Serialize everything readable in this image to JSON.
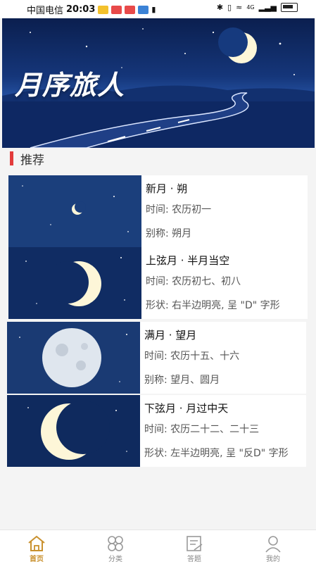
{
  "status_bar": {
    "carrier": "中国电信",
    "time": "20:03",
    "right_text": "4G"
  },
  "banner": {
    "title": "月序旅人"
  },
  "section": {
    "title": "推荐"
  },
  "cards": [
    {
      "title": "新月 · 朔",
      "line1": "时间:  农历初一",
      "line2": "别称:  朔月"
    },
    {
      "title": "上弦月 · 半月当空",
      "line1": "时间:  农历初七、初八",
      "line2": "形状:  右半边明亮, 呈 \"D\" 字形"
    },
    {
      "title": "满月 · 望月",
      "line1": "时间:  农历十五、十六",
      "line2": "别称:  望月、圆月"
    },
    {
      "title": "下弦月 · 月过中天",
      "line1": "时间:  农历二十二、二十三",
      "line2": "形状:  左半边明亮, 呈 \"反D\" 字形"
    }
  ],
  "nav": [
    {
      "label": "首页",
      "icon": "home-icon"
    },
    {
      "label": "分类",
      "icon": "category-icon"
    },
    {
      "label": "答题",
      "icon": "quiz-icon"
    },
    {
      "label": "我的",
      "icon": "profile-icon"
    }
  ],
  "colors": {
    "accent": "#c9912e",
    "section_bar": "#e23b3b",
    "banner_sky": "#15367a"
  }
}
